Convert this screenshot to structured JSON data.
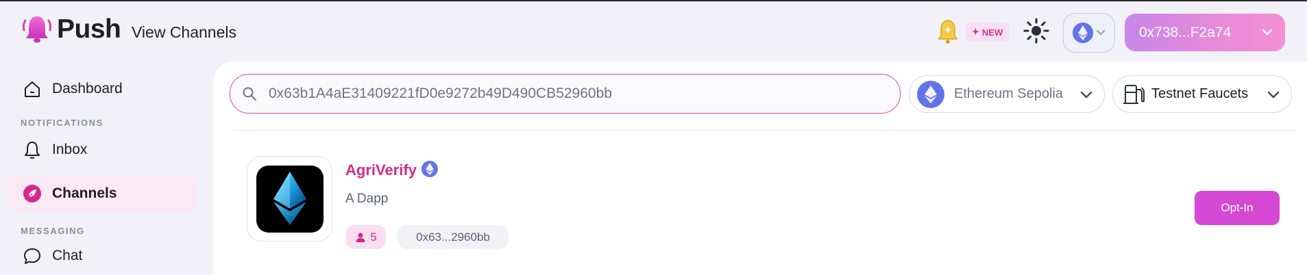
{
  "app": {
    "name": "Push",
    "page_title": "View Channels"
  },
  "header": {
    "new_badge": "NEW",
    "wallet_address": "0x738...F2a74"
  },
  "sidebar": {
    "items": [
      {
        "label": "Dashboard"
      },
      {
        "label": "Inbox"
      },
      {
        "label": "Channels"
      },
      {
        "label": "Chat"
      }
    ],
    "sections": {
      "notifications": "NOTIFICATIONS",
      "messaging": "MESSAGING"
    },
    "active": "Channels"
  },
  "search": {
    "value": "0x63b1A4aE31409221fD0e9272b49D490CB52960bb"
  },
  "filters": {
    "network": "Ethereum Sepolia",
    "faucets": "Testnet Faucets"
  },
  "channel": {
    "name": "AgriVerify",
    "description": "A Dapp",
    "subscribers": "5",
    "address": "0x63...2960bb",
    "action_label": "Opt-In"
  },
  "colors": {
    "accent": "#d4298d",
    "optin": "#d548d4",
    "eth": "#6573e8"
  }
}
